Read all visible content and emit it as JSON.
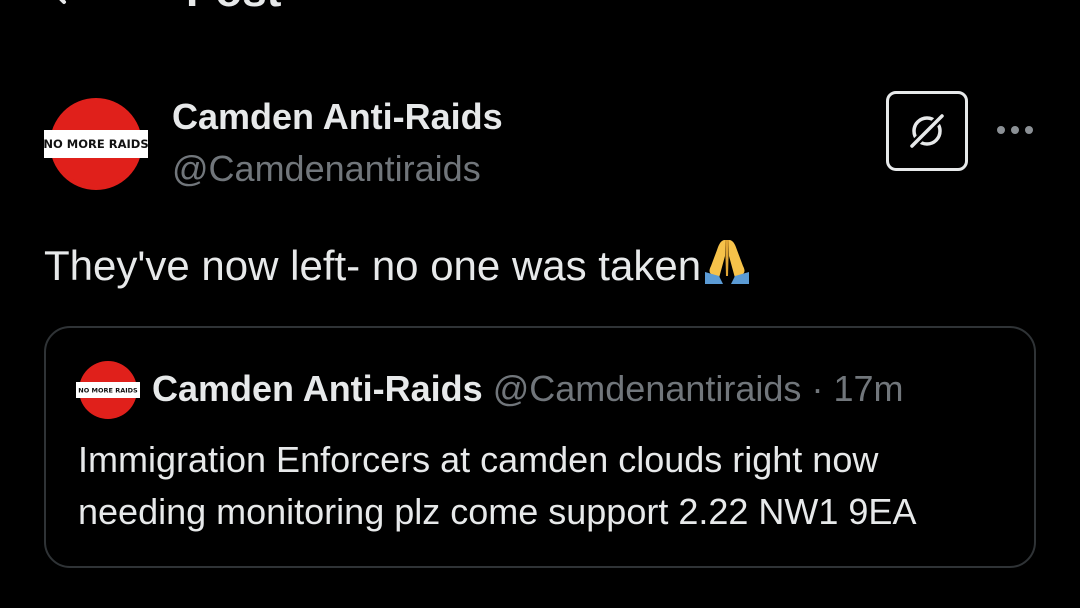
{
  "header": {
    "title": "Post"
  },
  "post": {
    "author_name": "Camden Anti-Raids",
    "author_handle": "@Camdenantiraids",
    "avatar_text": "NO MORE RAIDS",
    "text": "They've now left- no one was taken",
    "emoji": "folded-hands-emoji"
  },
  "quoted_post": {
    "author_name": "Camden Anti-Raids",
    "author_handle": "@Camdenantiraids",
    "separator": "·",
    "time": "17m",
    "text_line1": "Immigration Enforcers at camden clouds right now",
    "text_line2": "needing monitoring plz come support 2.22 NW1 9EA"
  },
  "icons": {
    "back": "back-arrow-icon",
    "grok": "grok-icon",
    "more": "more-options-icon"
  },
  "colors": {
    "background": "#000000",
    "text_primary": "#e7e9ea",
    "text_secondary": "#71767b",
    "border": "#2f3336",
    "avatar_red": "#e0201b"
  }
}
